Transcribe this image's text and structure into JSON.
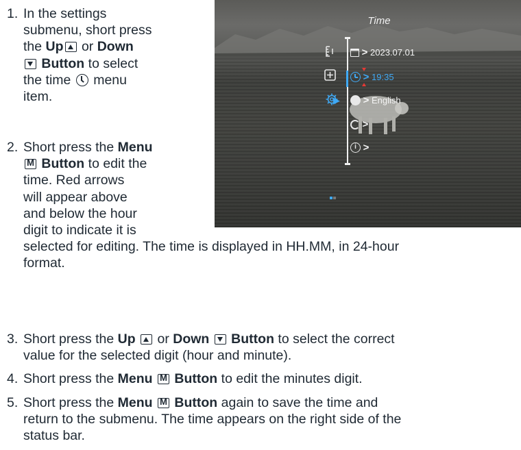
{
  "steps": [
    {
      "number": "1.",
      "lines": [
        [
          "In the settings"
        ],
        [
          "submenu, short press"
        ],
        [
          "the ",
          {
            "b": "Up"
          },
          {
            "key": "up"
          },
          " or ",
          {
            "b": "Down"
          }
        ],
        [
          {
            "key": "down"
          },
          {
            "b": " Button"
          },
          " to select"
        ],
        [
          "the time ",
          {
            "icon": "clock"
          },
          " menu"
        ],
        [
          "item."
        ]
      ]
    },
    {
      "number": "2.",
      "lines": [
        [
          "Short press the ",
          {
            "b": "Menu"
          }
        ],
        [
          {
            "key": "m"
          },
          {
            "b": " Button"
          },
          " to edit the"
        ],
        [
          "time. Red arrows"
        ],
        [
          "will appear above"
        ],
        [
          "and below the hour"
        ],
        [
          "digit to indicate it is"
        ],
        [
          "selected for editing. The time is displayed in HH.MM, in 24-hour"
        ],
        [
          "format."
        ]
      ]
    },
    {
      "number": "3.",
      "lines": [
        [
          "Short press the ",
          {
            "b": "Up"
          },
          " ",
          {
            "key": "up"
          },
          " or ",
          {
            "b": "Down"
          },
          " ",
          {
            "key": "down"
          },
          {
            "b": " Button"
          },
          " to select the correct"
        ],
        [
          "value for the selected digit (hour and minute)."
        ]
      ]
    },
    {
      "number": "4.",
      "lines": [
        [
          "Short press the ",
          {
            "b": "Menu"
          },
          " ",
          {
            "key": "m"
          },
          {
            "b": " Button"
          },
          " to edit the minutes digit."
        ]
      ]
    },
    {
      "number": "5.",
      "lines": [
        [
          "Short press the ",
          {
            "b": "Menu"
          },
          " ",
          {
            "key": "m"
          },
          {
            "b": " Button"
          },
          " again to save the time and"
        ],
        [
          "return to the submenu. The time appears on the right side of the"
        ],
        [
          "status bar."
        ]
      ]
    }
  ],
  "keys": {
    "m": "M"
  },
  "screen": {
    "title": "Time",
    "date_value": "2023.07.01",
    "time_value": "19:35",
    "language_value": "English",
    "chevron": ">",
    "info_glyph": "i",
    "accent_color": "#3fa9f5",
    "edit_arrow_color": "#e53935",
    "left_icons": [
      "ruler-icon",
      "plus-box-icon",
      "gear-icon"
    ],
    "menu_icons": [
      "calendar-icon",
      "clock-icon",
      "globe-icon",
      "reset-icon",
      "info-icon"
    ]
  }
}
